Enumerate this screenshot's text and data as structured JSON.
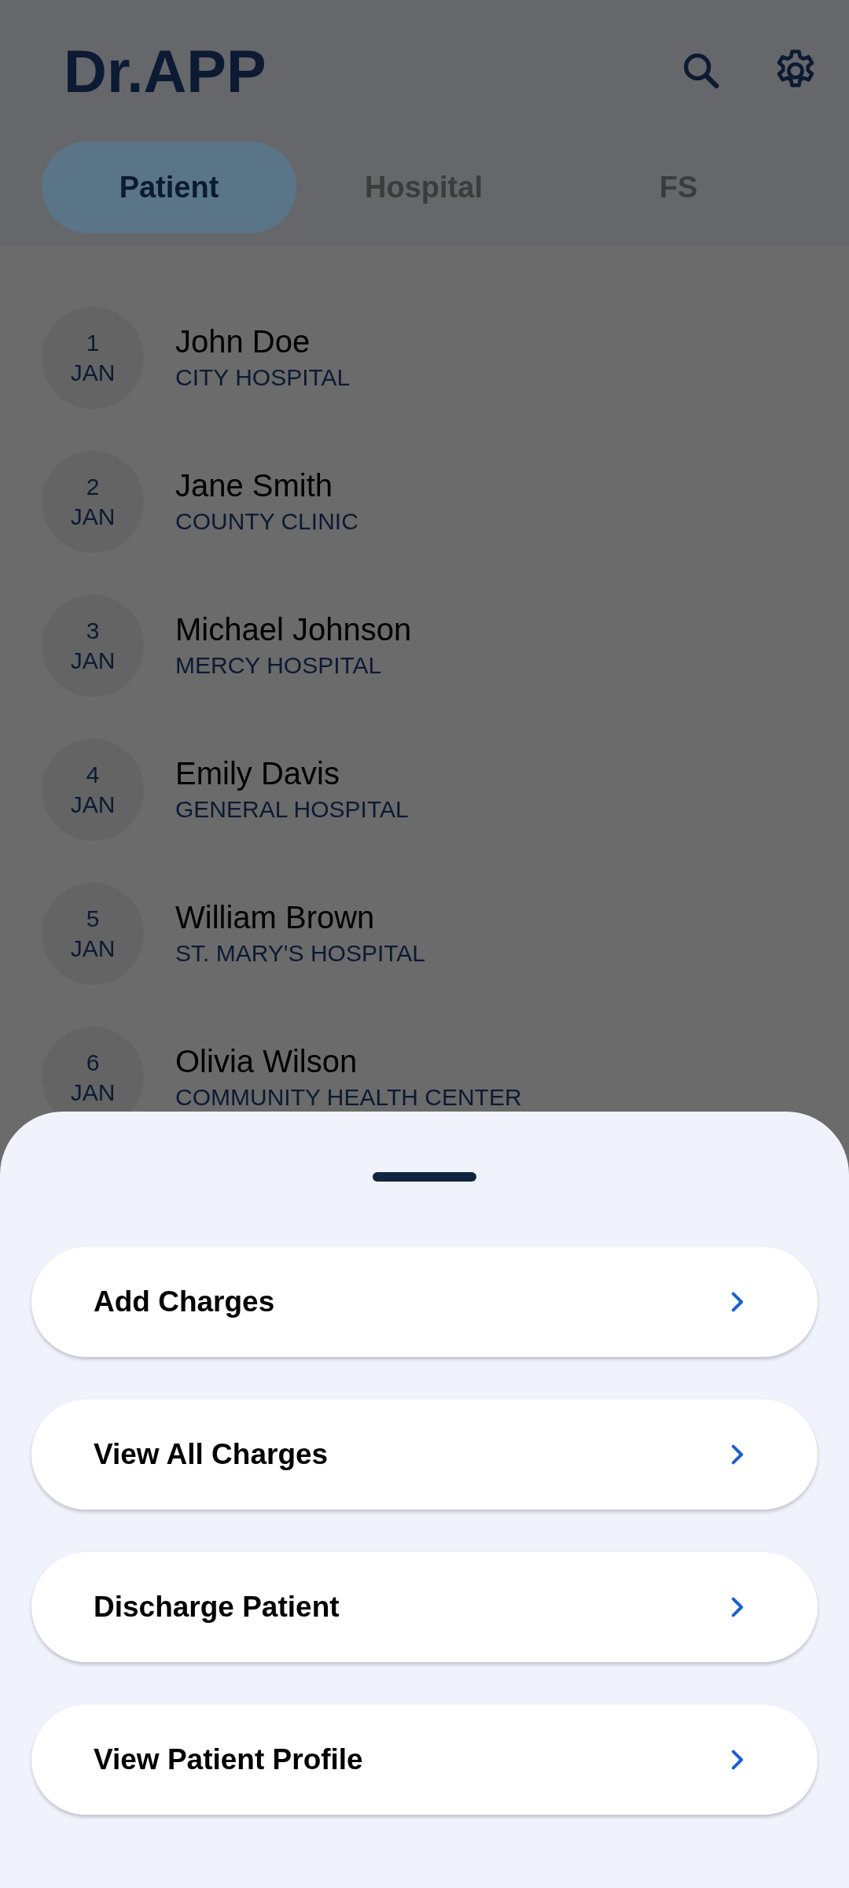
{
  "app_bar": {
    "title": "Dr.APP"
  },
  "tabs": [
    {
      "label": "Patient",
      "selected": true
    },
    {
      "label": "Hospital",
      "selected": false
    },
    {
      "label": "FS",
      "selected": false
    }
  ],
  "patients": [
    {
      "day": "1",
      "month": "JAN",
      "name": "John Doe",
      "hospital": "CITY HOSPITAL"
    },
    {
      "day": "2",
      "month": "JAN",
      "name": "Jane Smith",
      "hospital": "COUNTY CLINIC"
    },
    {
      "day": "3",
      "month": "JAN",
      "name": "Michael Johnson",
      "hospital": "MERCY HOSPITAL"
    },
    {
      "day": "4",
      "month": "JAN",
      "name": "Emily Davis",
      "hospital": "GENERAL HOSPITAL"
    },
    {
      "day": "5",
      "month": "JAN",
      "name": "William Brown",
      "hospital": "ST. MARY'S HOSPITAL"
    },
    {
      "day": "6",
      "month": "JAN",
      "name": "Olivia Wilson",
      "hospital": "COMMUNITY HEALTH CENTER"
    }
  ],
  "bottom_sheet": {
    "actions": [
      "Add Charges",
      "View All Charges",
      "Discharge Patient",
      "View Patient Profile"
    ]
  }
}
